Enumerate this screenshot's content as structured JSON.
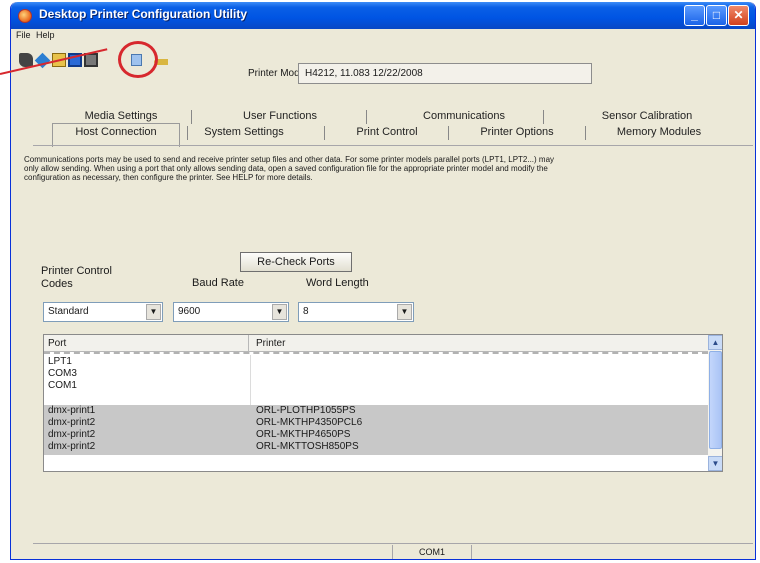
{
  "window": {
    "title": "Desktop Printer Configuration Utility"
  },
  "menu": [
    "File",
    "Help"
  ],
  "toolbar": {
    "icons": [
      "binoculars-icon",
      "wrench-icon",
      "open-folder-icon",
      "save-icon",
      "print-icon",
      "page-icon",
      "key-icon"
    ],
    "highlighted": "page-icon"
  },
  "printer_model": {
    "label": "Printer Model:",
    "value": "H4212, 11.083 12/22/2008"
  },
  "tabs": {
    "row1": [
      "Media Settings",
      "User Functions",
      "Communications",
      "Sensor Calibration"
    ],
    "row2": [
      "Host Connection",
      "System Settings",
      "Print Control",
      "Printer Options",
      "Memory Modules"
    ],
    "active": "Host Connection"
  },
  "description": "Communications ports may be used to send and receive printer setup files and other data. For some printer models parallel ports (LPT1, LPT2...) may only allow sending. When using a port that only allows sending data, open a saved configuration file for the appropriate printer model and modify the configuration as necessary, then configure the printer. See HELP for more details.",
  "recheck_button": "Re-Check Ports",
  "fields": {
    "printer_control": {
      "label": "Printer Control Codes",
      "value": "Standard"
    },
    "baud_rate": {
      "label": "Baud Rate",
      "value": "9600"
    },
    "word_length": {
      "label": "Word Length",
      "value": "8"
    }
  },
  "grid": {
    "columns": [
      "Port",
      "Printer"
    ],
    "rows": [
      {
        "port": "LPT1",
        "printer": "",
        "selected": false
      },
      {
        "port": "COM3",
        "printer": "",
        "selected": false
      },
      {
        "port": "COM1",
        "printer": "",
        "selected": false
      },
      {
        "port": "dmx-print1",
        "printer": "ORL-PLOTHP1055PS",
        "selected": true
      },
      {
        "port": "dmx-print2",
        "printer": "ORL-MKTHP4350PCL6",
        "selected": true
      },
      {
        "port": "dmx-print2",
        "printer": "ORL-MKTHP4650PS",
        "selected": true
      },
      {
        "port": "dmx-print2",
        "printer": "ORL-MKTTOSH850PS",
        "selected": true
      }
    ]
  },
  "status": {
    "port": "COM1"
  },
  "colors": {
    "titlebar": "#0054e3",
    "window_bg": "#ece9d8",
    "callout": "#d7282e",
    "selection": "#c8c8c8"
  }
}
